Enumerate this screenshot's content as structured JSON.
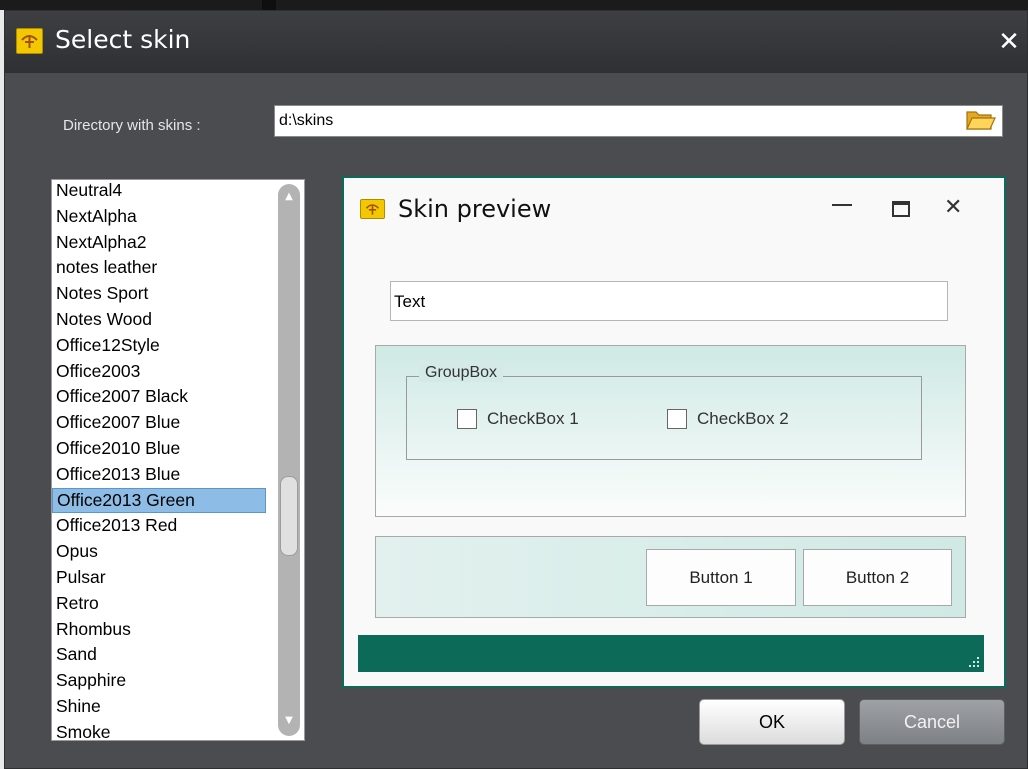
{
  "dialog": {
    "title": "Select skin",
    "close_glyph": "✕",
    "icon": "app-logo-icon"
  },
  "directory": {
    "label": "Directory with skins :",
    "value": "d:\\skins",
    "browse_icon": "folder-open-icon"
  },
  "skin_list": {
    "items": [
      "Neutral4",
      "NextAlpha",
      "NextAlpha2",
      "notes leather",
      "Notes Sport",
      "Notes Wood",
      "Office12Style",
      "Office2003",
      "Office2007 Black",
      "Office2007 Blue",
      "Office2010 Blue",
      "Office2013 Blue",
      "Office2013 Green",
      "Office2013 Red",
      "Opus",
      "Pulsar",
      "Retro",
      "Rhombus",
      "Sand",
      "Sapphire",
      "Shine",
      "Smoke"
    ],
    "selected": "Office2013 Green"
  },
  "preview": {
    "title": "Skin preview",
    "minimize_glyph": "—",
    "close_glyph": "✕",
    "text_field": "Text",
    "groupbox_label": "GroupBox",
    "checkbox1": "CheckBox 1",
    "checkbox2": "CheckBox 2",
    "button1": "Button 1",
    "button2": "Button 2",
    "accent_color": "#0b6b58"
  },
  "footer": {
    "ok": "OK",
    "cancel": "Cancel"
  }
}
